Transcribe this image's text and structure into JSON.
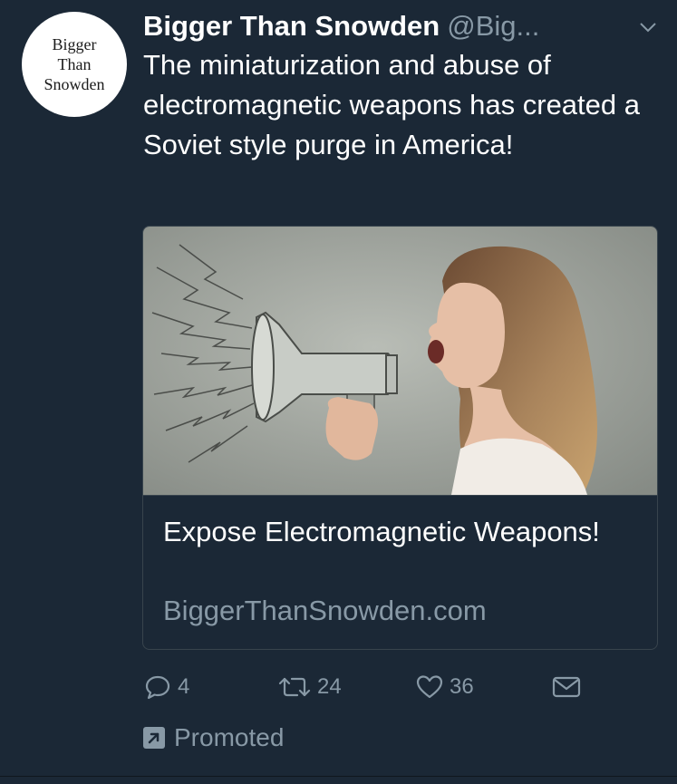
{
  "tweet": {
    "avatar_lines": [
      "Bigger",
      "Than",
      "Snowden"
    ],
    "display_name": "Bigger Than Snowden",
    "handle": "@Big...",
    "text": "The miniaturization and abuse of electromagnetic weapons has created a Soviet style purge in America!",
    "card": {
      "title": "Expose Electromagnetic Weapons!",
      "domain": "BiggerThanSnowden.com"
    },
    "actions": {
      "replies": "4",
      "retweets": "24",
      "likes": "36"
    },
    "promoted_label": "Promoted"
  },
  "icons": {
    "caret": "chevron-down-icon",
    "reply": "reply-icon",
    "retweet": "retweet-icon",
    "like": "heart-icon",
    "message": "envelope-icon",
    "promoted": "promoted-arrow-icon"
  },
  "colors": {
    "background": "#1b2836",
    "secondary_text": "#8899a6",
    "border": "#38444d"
  }
}
